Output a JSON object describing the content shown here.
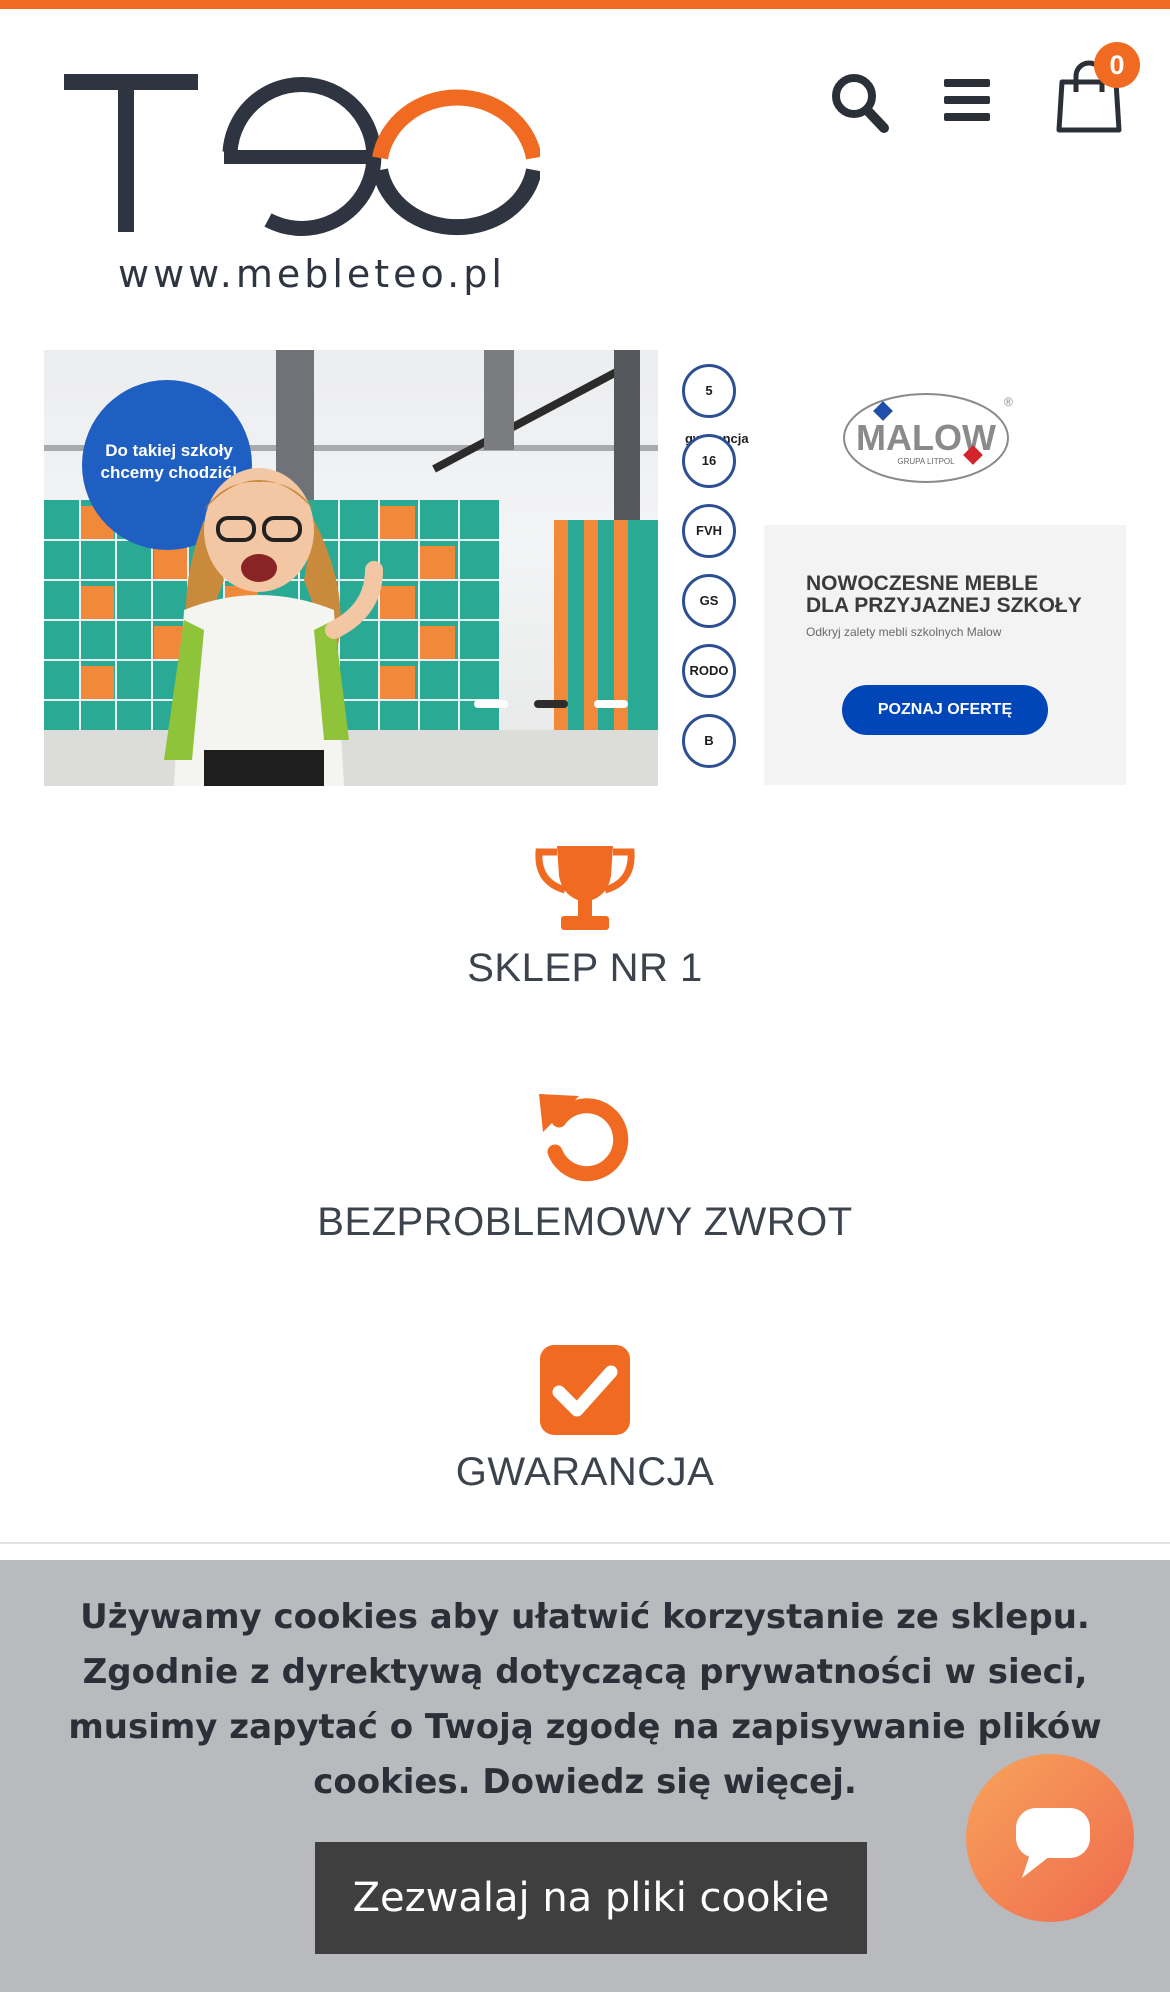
{
  "header": {
    "logo_url_text": "www.mebleteo.pl",
    "cart_count": "0",
    "icons": [
      "search-icon",
      "menu-icon",
      "shopping-bag-icon"
    ]
  },
  "banner": {
    "bubble_text": "Do takiej szkoły chcemy chodzić!",
    "slider_dots": 3,
    "active_dot": 1
  },
  "certificates": [
    "5 gwarancja",
    "16",
    "FVH",
    "GS",
    "RODO",
    "B"
  ],
  "ad": {
    "brand": "MALOW",
    "brand_sub": "GRUPA LITPOL",
    "title_line1": "NOWOCZESNE MEBLE",
    "title_line2": "DLA PRZYJAZNEJ SZKOŁY",
    "subtitle": "Odkryj zalety mebli szkolnych Malow",
    "button": "POZNAJ OFERTĘ"
  },
  "features": [
    {
      "label": "SKLEP NR 1",
      "icon": "trophy-icon"
    },
    {
      "label": "BEZPROBLEMOWY ZWROT",
      "icon": "undo-icon"
    },
    {
      "label": "GWARANCJA",
      "icon": "check-square-icon"
    }
  ],
  "cookie": {
    "text": "Używamy cookies aby ułatwić korzystanie ze sklepu. Zgodnie z dyrektywą dotyczącą prywatności w sieci, musimy zapytać o Twoją zgodę na zapisywanie plików cookies. Dowiedz się więcej.",
    "button": "Zezwalaj na pliki cookie"
  },
  "colors": {
    "accent": "#f06a22",
    "dark": "#2f3540",
    "ad_button": "#0046b9",
    "cookie_bg": "#b9babd",
    "cookie_button": "#3f3f40"
  }
}
